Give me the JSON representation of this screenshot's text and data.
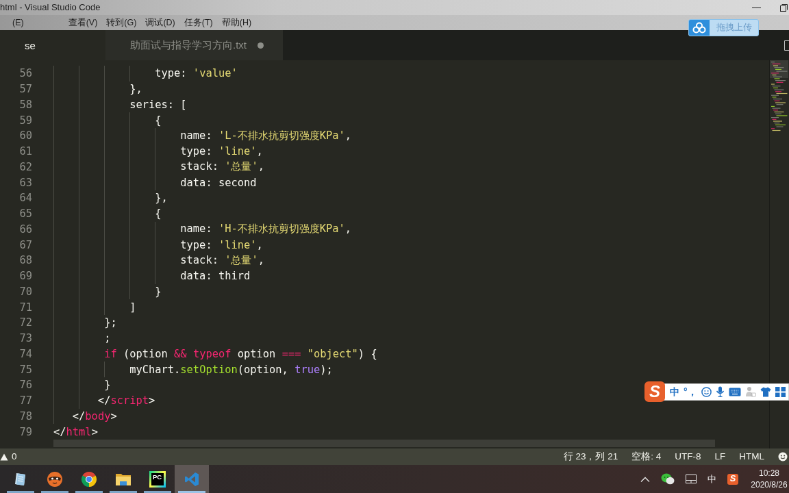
{
  "window": {
    "title": "html - Visual Studio Code"
  },
  "menu": [
    "(E)",
    "查看(V)",
    "转到(G)",
    "调试(D)",
    "任务(T)",
    "帮助(H)"
  ],
  "upload_widget": {
    "label": "拖拽上传"
  },
  "tabs": [
    {
      "label": "se",
      "selected": true,
      "modified": false
    },
    {
      "label": "助面试与指导学习方向.txt",
      "selected": false,
      "modified": true
    }
  ],
  "editor": {
    "lines": [
      {
        "number": "56",
        "tokens": [
          {
            "kind": "plain",
            "text": "                type: "
          },
          {
            "kind": "string",
            "text": "'value'"
          }
        ]
      },
      {
        "number": "57",
        "tokens": [
          {
            "kind": "plain",
            "text": "            },"
          }
        ]
      },
      {
        "number": "58",
        "tokens": [
          {
            "kind": "plain",
            "text": "            series: ["
          }
        ]
      },
      {
        "number": "59",
        "tokens": [
          {
            "kind": "plain",
            "text": "                {"
          }
        ]
      },
      {
        "number": "60",
        "tokens": [
          {
            "kind": "plain",
            "text": "                    name: "
          },
          {
            "kind": "string",
            "text": "'L-不排水抗剪切强度KPa'"
          },
          {
            "kind": "plain",
            "text": ","
          }
        ]
      },
      {
        "number": "61",
        "tokens": [
          {
            "kind": "plain",
            "text": "                    type: "
          },
          {
            "kind": "string",
            "text": "'line'"
          },
          {
            "kind": "plain",
            "text": ","
          }
        ]
      },
      {
        "number": "62",
        "tokens": [
          {
            "kind": "plain",
            "text": "                    stack: "
          },
          {
            "kind": "string",
            "text": "'总量'"
          },
          {
            "kind": "plain",
            "text": ","
          }
        ]
      },
      {
        "number": "63",
        "tokens": [
          {
            "kind": "plain",
            "text": "                    data: second"
          }
        ]
      },
      {
        "number": "64",
        "tokens": [
          {
            "kind": "plain",
            "text": "                },"
          }
        ]
      },
      {
        "number": "65",
        "tokens": [
          {
            "kind": "plain",
            "text": "                {"
          }
        ]
      },
      {
        "number": "66",
        "tokens": [
          {
            "kind": "plain",
            "text": "                    name: "
          },
          {
            "kind": "string",
            "text": "'H-不排水抗剪切强度KPa'"
          },
          {
            "kind": "plain",
            "text": ","
          }
        ]
      },
      {
        "number": "67",
        "tokens": [
          {
            "kind": "plain",
            "text": "                    type: "
          },
          {
            "kind": "string",
            "text": "'line'"
          },
          {
            "kind": "plain",
            "text": ","
          }
        ]
      },
      {
        "number": "68",
        "tokens": [
          {
            "kind": "plain",
            "text": "                    stack: "
          },
          {
            "kind": "string",
            "text": "'总量'"
          },
          {
            "kind": "plain",
            "text": ","
          }
        ]
      },
      {
        "number": "69",
        "tokens": [
          {
            "kind": "plain",
            "text": "                    data: third"
          }
        ]
      },
      {
        "number": "70",
        "tokens": [
          {
            "kind": "plain",
            "text": "                }"
          }
        ]
      },
      {
        "number": "71",
        "tokens": [
          {
            "kind": "plain",
            "text": "            ]"
          }
        ]
      },
      {
        "number": "72",
        "tokens": [
          {
            "kind": "plain",
            "text": "        };"
          }
        ]
      },
      {
        "number": "73",
        "tokens": [
          {
            "kind": "plain",
            "text": "        ;"
          }
        ]
      },
      {
        "number": "74",
        "tokens": [
          {
            "kind": "keyword",
            "text": "        if"
          },
          {
            "kind": "plain",
            "text": " (option "
          },
          {
            "kind": "keyword",
            "text": "&&"
          },
          {
            "kind": "keyword",
            "text": " typeof"
          },
          {
            "kind": "plain",
            "text": " option "
          },
          {
            "kind": "keyword",
            "text": "==="
          },
          {
            "kind": "string",
            "text": " \"object\""
          },
          {
            "kind": "plain",
            "text": ") {"
          }
        ]
      },
      {
        "number": "75",
        "tokens": [
          {
            "kind": "plain",
            "text": "            myChart."
          },
          {
            "kind": "function",
            "text": "setOption"
          },
          {
            "kind": "plain",
            "text": "(option, "
          },
          {
            "kind": "constant",
            "text": "true"
          },
          {
            "kind": "plain",
            "text": ");"
          }
        ]
      },
      {
        "number": "76",
        "tokens": [
          {
            "kind": "plain",
            "text": "        }"
          }
        ]
      },
      {
        "number": "77",
        "tokens": [
          {
            "kind": "plain",
            "text": "       </"
          },
          {
            "kind": "tag",
            "text": "script"
          },
          {
            "kind": "plain",
            "text": ">"
          }
        ]
      },
      {
        "number": "78",
        "tokens": [
          {
            "kind": "plain",
            "text": "   </"
          },
          {
            "kind": "tag",
            "text": "body"
          },
          {
            "kind": "plain",
            "text": ">"
          }
        ]
      },
      {
        "number": "79",
        "tokens": [
          {
            "kind": "plain",
            "text": "</"
          },
          {
            "kind": "tag",
            "text": "html"
          },
          {
            "kind": "plain",
            "text": ">"
          }
        ]
      }
    ]
  },
  "ime_toolbar": {
    "logo": "S",
    "mode": "中",
    "punctuation": "°，"
  },
  "status_bar": {
    "problems": "0",
    "items": [
      "行 23，列 21",
      "空格: 4",
      "UTF-8",
      "LF",
      "HTML"
    ]
  },
  "taskbar": {
    "apps": [
      {
        "kind": "notebook",
        "active": false,
        "running": true
      },
      {
        "kind": "mascot",
        "active": false,
        "running": true
      },
      {
        "kind": "browser",
        "active": false,
        "running": true
      },
      {
        "kind": "folder",
        "active": false,
        "running": true
      },
      {
        "kind": "ide",
        "label": "PC",
        "active": false,
        "running": true
      },
      {
        "kind": "editor",
        "active": true,
        "running": true
      }
    ],
    "tray": {
      "ime_mode": "中",
      "ime_logo": "S",
      "time": "10:28",
      "date": "2020/8/26"
    }
  }
}
